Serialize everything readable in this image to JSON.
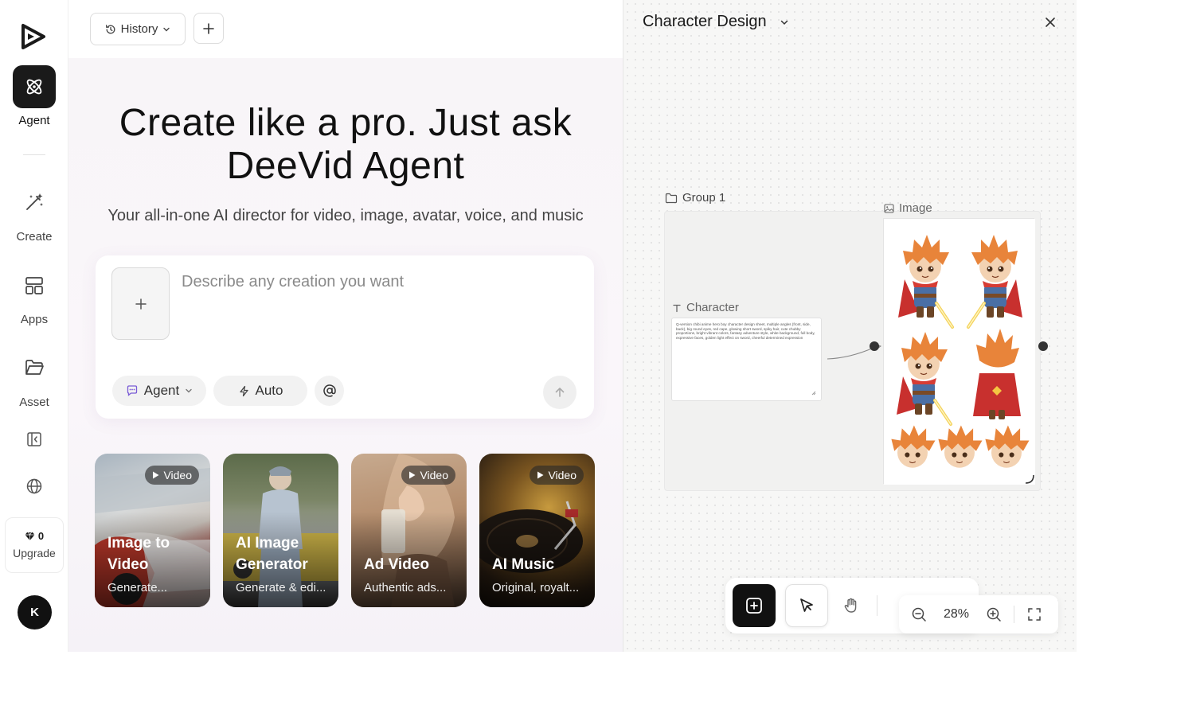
{
  "sidebar": {
    "agent_label": "Agent",
    "create_label": "Create",
    "apps_label": "Apps",
    "asset_label": "Asset",
    "gems_count": "0",
    "upgrade_label": "Upgrade",
    "avatar_initial": "K"
  },
  "topbar": {
    "history_label": "History"
  },
  "hero": {
    "title_line1": "Create like a pro. Just ask",
    "title_line2": "DeeVid Agent",
    "subtitle": "Your all-in-one AI director for video, image, avatar, voice, and music"
  },
  "prompt": {
    "placeholder": "Describe any creation you want",
    "agent_chip": "Agent",
    "auto_chip": "Auto"
  },
  "cards": [
    {
      "badge": "Video",
      "title": "Image to Video",
      "desc": "Generate..."
    },
    {
      "badge": "",
      "title": "AI Image Generator",
      "desc": "Generate & edi..."
    },
    {
      "badge": "Video",
      "title": "Ad Video",
      "desc": "Authentic ads..."
    },
    {
      "badge": "Video",
      "title": "AI Music",
      "desc": "Original, royalt..."
    }
  ],
  "panel": {
    "title": "Character Design",
    "group_label": "Group 1",
    "character_label": "Character",
    "character_text": "Q-version chibi anime hero boy character design sheet, multiple angles (front, side, back), big round eyes, red cape, glowing short sword, spiky hair, cute chubby proportions, bright vibrant colors, fantasy adventure style, white background, full body, expressive faces, golden light effect on sword, cheerful determined expression",
    "image_label": "Image",
    "zoom": "28%"
  },
  "colors": {
    "accent_dark": "#111111",
    "panel_bg": "#f7f7f6",
    "hair": "#e8843a",
    "cape": "#c8302e",
    "tunic": "#4a6fa5"
  }
}
